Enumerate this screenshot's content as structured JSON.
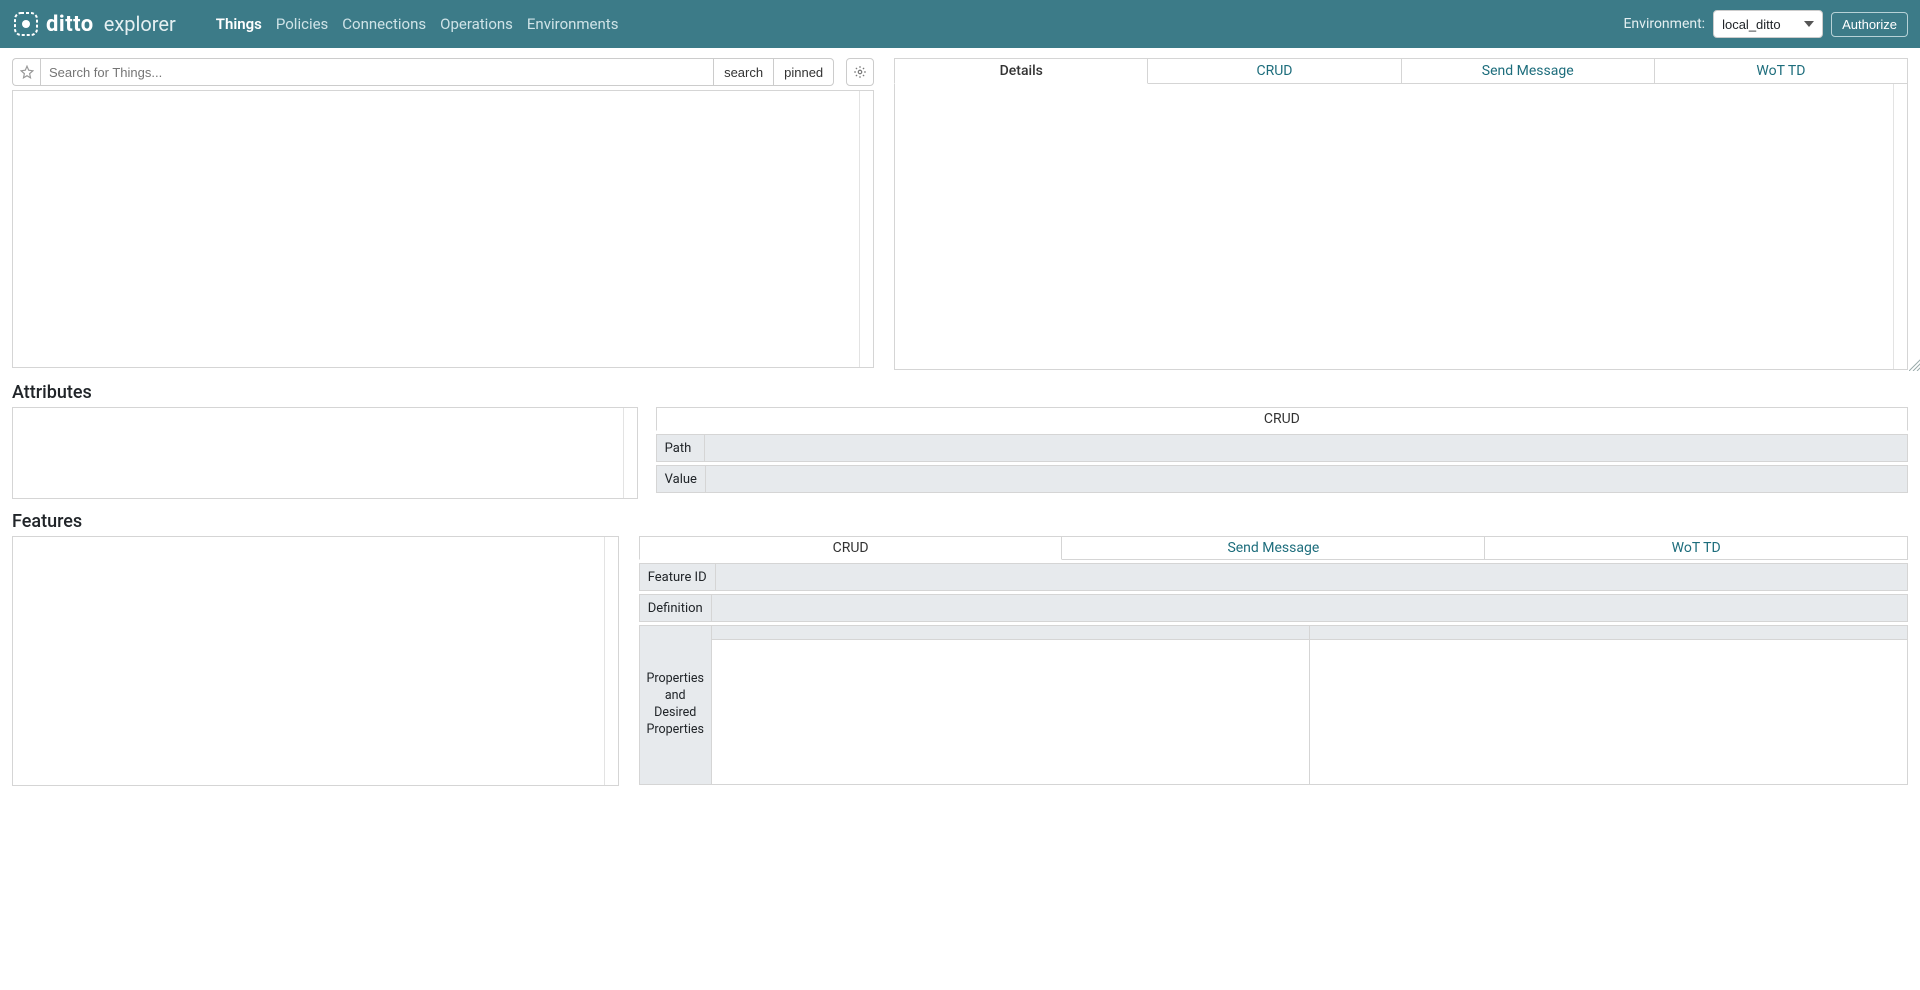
{
  "brand": {
    "name": "ditto",
    "sub": "explorer"
  },
  "nav": {
    "items": [
      "Things",
      "Policies",
      "Connections",
      "Operations",
      "Environments"
    ],
    "active_index": 0
  },
  "env": {
    "label": "Environment:",
    "selected": "local_ditto",
    "authorize": "Authorize"
  },
  "search": {
    "placeholder": "Search for Things...",
    "search_btn": "search",
    "pinned_btn": "pinned"
  },
  "thing_tabs": {
    "items": [
      "Details",
      "CRUD",
      "Send Message",
      "WoT TD"
    ],
    "active_index": 0
  },
  "attributes": {
    "heading": "Attributes",
    "tab": "CRUD",
    "path_label": "Path",
    "value_label": "Value"
  },
  "features": {
    "heading": "Features",
    "tabs": {
      "items": [
        "CRUD",
        "Send Message",
        "WoT TD"
      ],
      "active_index": 0
    },
    "feature_id_label": "Feature ID",
    "definition_label": "Definition",
    "props_label": "Properties and Desired Properties"
  }
}
